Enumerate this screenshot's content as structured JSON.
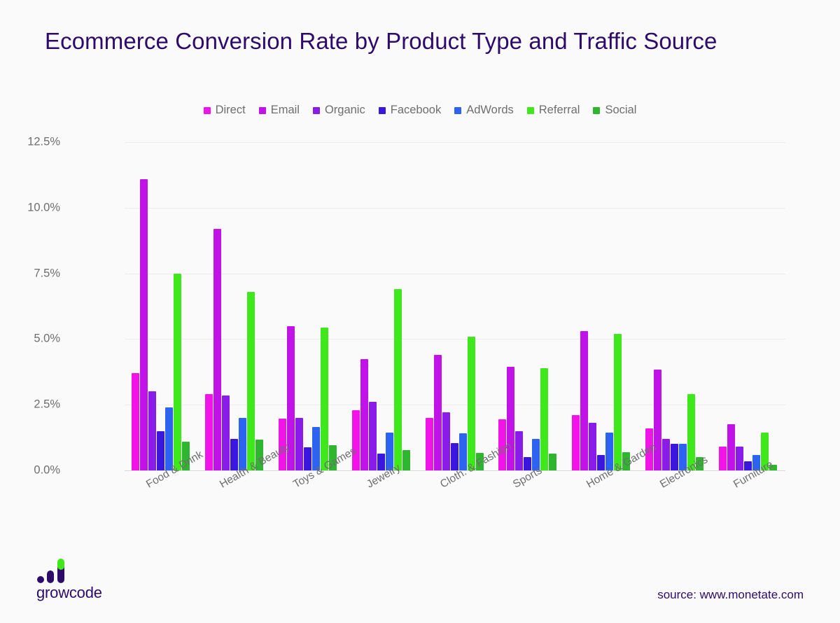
{
  "title": "Ecommerce Conversion Rate by Product Type and Traffic Source",
  "footer": {
    "logo_text": "growcode",
    "source": "source: www.monetate.com"
  },
  "colors": {
    "background": "#FAFAFA",
    "title": "#2E0B6B",
    "tick_text": "#6E6E6E",
    "gridline": "#ECECEC",
    "axis": "#D8D8D8"
  },
  "chart_data": {
    "type": "bar",
    "title": "Ecommerce Conversion Rate by Product Type and Traffic Source",
    "xlabel": "",
    "ylabel": "",
    "ylim": [
      0,
      12.5
    ],
    "grid": true,
    "legend_position": "top-center",
    "ytick_labels": [
      "12.5%",
      "10.0%",
      "7.5%",
      "5.0%",
      "2.5%",
      "0.0%"
    ],
    "ytick_values": [
      12.5,
      10.0,
      7.5,
      5.0,
      2.5,
      0.0
    ],
    "categories": [
      "Food & Drink",
      "Health & Beauty",
      "Toys & Games",
      "Jewelry",
      "Cloth. & Fashion",
      "Sports",
      "Home & Garden",
      "Electronics",
      "Furniture"
    ],
    "series": [
      {
        "name": "Direct",
        "color": "#F213E8",
        "values": [
          3.7,
          2.9,
          1.98,
          2.3,
          2.0,
          1.95,
          2.1,
          1.6,
          0.9
        ]
      },
      {
        "name": "Email",
        "color": "#C113E8",
        "values": [
          11.1,
          9.2,
          5.5,
          4.25,
          4.4,
          3.95,
          5.3,
          3.85,
          1.75
        ]
      },
      {
        "name": "Organic",
        "color": "#8B1BE8",
        "values": [
          3.02,
          2.85,
          2.0,
          2.6,
          2.2,
          1.5,
          1.8,
          1.2,
          0.9
        ]
      },
      {
        "name": "Facebook",
        "color": "#3B16DE",
        "values": [
          1.5,
          1.2,
          0.88,
          0.65,
          1.05,
          0.5,
          0.6,
          1.0,
          0.35
        ]
      },
      {
        "name": "AdWords",
        "color": "#2C63F0",
        "values": [
          2.4,
          2.0,
          1.65,
          1.45,
          1.4,
          1.2,
          1.45,
          1.0,
          0.6
        ]
      },
      {
        "name": "Referral",
        "color": "#3EE81B",
        "values": [
          7.48,
          6.8,
          5.45,
          6.9,
          5.1,
          3.9,
          5.2,
          2.9,
          1.45
        ]
      },
      {
        "name": "Social",
        "color": "#2FB62F",
        "values": [
          1.1,
          1.18,
          0.95,
          0.78,
          0.68,
          0.65,
          0.7,
          0.5,
          0.22
        ]
      }
    ]
  }
}
